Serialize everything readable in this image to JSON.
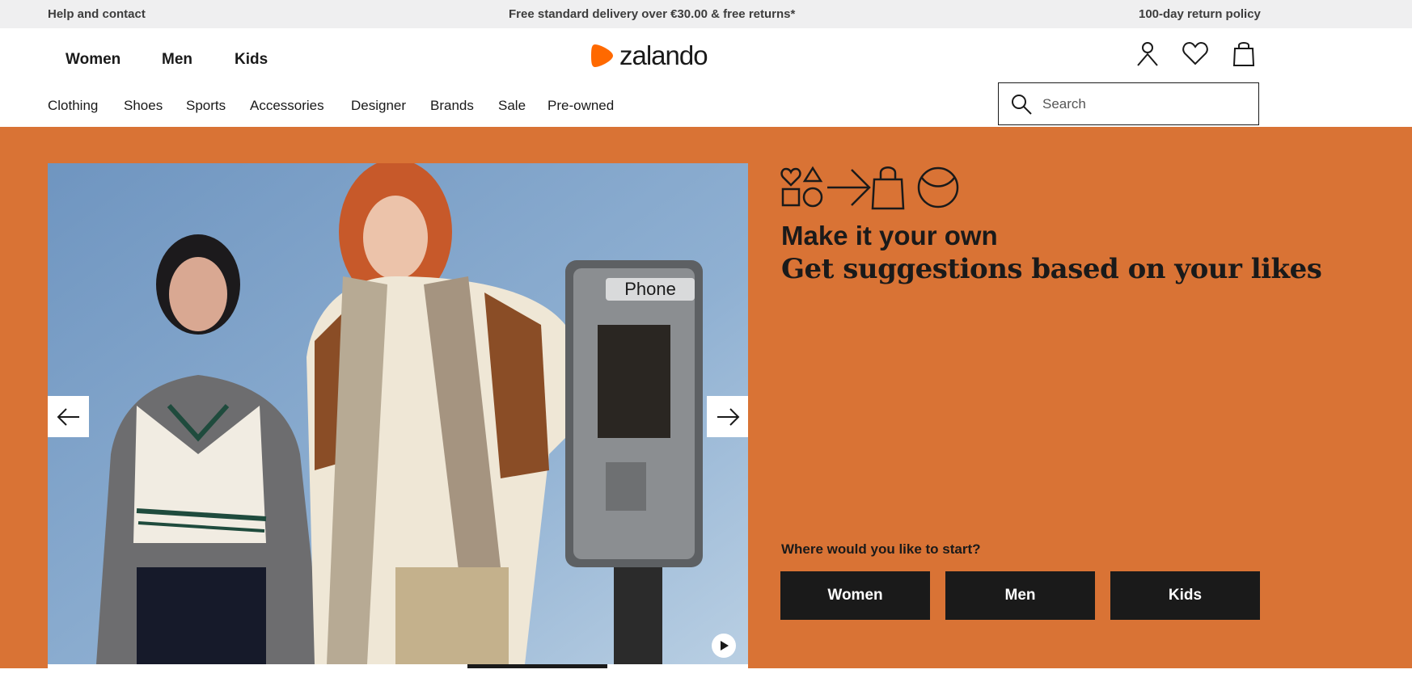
{
  "topbar": {
    "help": "Help and contact",
    "delivery": "Free standard delivery over €30.00 & free returns*",
    "returns": "100-day return policy"
  },
  "header": {
    "gender_nav": [
      "Women",
      "Men",
      "Kids"
    ],
    "logo_text": "zalando",
    "icons": [
      "account-icon",
      "wishlist-heart-icon",
      "shopping-bag-icon"
    ],
    "categories": [
      "Clothing",
      "Shoes",
      "Sports",
      "Accessories",
      "Designer",
      "Brands",
      "Sale",
      "Pre-owned"
    ],
    "search_placeholder": "Search"
  },
  "hero": {
    "icons": [
      "heart-shapes-icon",
      "arrow-right-icon",
      "bag-icon",
      "smile-icon"
    ],
    "title": "Make it your own",
    "subtitle": "Get suggestions based on your likes",
    "question": "Where would you like to start?",
    "buttons": [
      "Women",
      "Men",
      "Kids"
    ],
    "photo_sign_text": "Phone",
    "carousel_controls": [
      "arrow-left-icon",
      "arrow-right-icon",
      "play-icon"
    ],
    "carousel_progress": 0.2
  },
  "colors": {
    "hero_bg": "#d97335",
    "logo_orange": "#ff6900",
    "button_bg": "#1a1a1a",
    "topbar_bg": "#efeff0"
  }
}
